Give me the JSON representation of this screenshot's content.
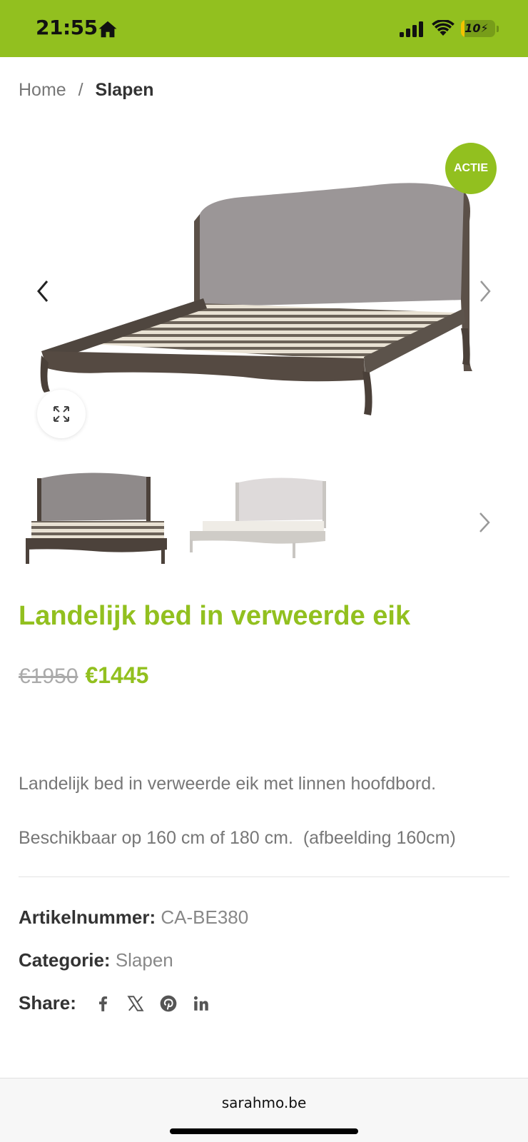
{
  "status_bar": {
    "time": "21:55",
    "battery_level": "10",
    "bg_color": "#92c01f"
  },
  "breadcrumb": {
    "home": "Home",
    "separator": "/",
    "current": "Slapen"
  },
  "gallery": {
    "sale_badge": "ACTIE",
    "icons": [
      "chevron-left-icon",
      "chevron-right-icon",
      "expand-icon"
    ]
  },
  "product": {
    "title": "Landelijk bed in verweerde eik",
    "price_old": "€1950",
    "price_new": "€1445",
    "description_1": "Landelijk bed in verweerde eik met linnen hoofdbord.",
    "description_2": "Beschikbaar op 160 cm of 180 cm.  (afbeelding 160cm)",
    "sku_label": "Artikelnummer:",
    "sku_value": "CA-BE380",
    "category_label": "Categorie:",
    "category_value": "Slapen",
    "share_label": "Share:",
    "share_icons": [
      "facebook-icon",
      "x-icon",
      "pinterest-icon",
      "linkedin-icon"
    ]
  },
  "browser": {
    "url": "sarahmo.be"
  },
  "colors": {
    "accent": "#92c01f",
    "text": "#333333",
    "muted": "#777777"
  }
}
